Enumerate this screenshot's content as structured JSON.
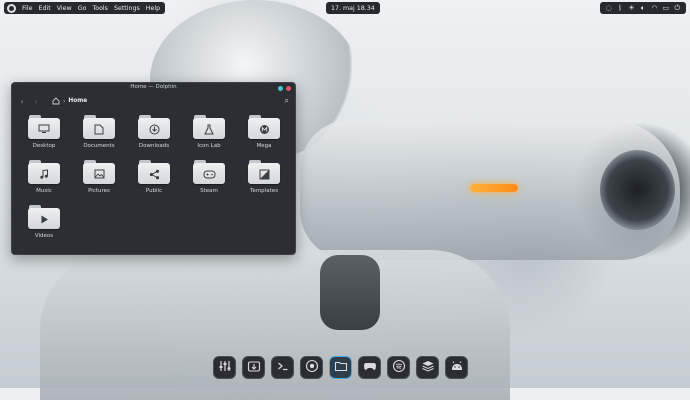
{
  "topbar": {
    "menu": [
      "File",
      "Edit",
      "View",
      "Go",
      "Tools",
      "Settings",
      "Help"
    ],
    "clock": "17. maj 18.34",
    "tray_icons": [
      "globe-icon",
      "bluetooth-icon",
      "sun-icon",
      "volume-icon",
      "wifi-icon",
      "battery-icon",
      "power-icon"
    ]
  },
  "window": {
    "title": "Home — Dolphin",
    "breadcrumb_current": "Home",
    "folders": [
      {
        "label": "Desktop",
        "icon": "desktop"
      },
      {
        "label": "Documents",
        "icon": "documents"
      },
      {
        "label": "Downloads",
        "icon": "downloads"
      },
      {
        "label": "Icon Lab",
        "icon": "flask"
      },
      {
        "label": "Mega",
        "icon": "mega"
      },
      {
        "label": "Music",
        "icon": "music"
      },
      {
        "label": "Pictures",
        "icon": "pictures"
      },
      {
        "label": "Public",
        "icon": "share"
      },
      {
        "label": "Steam",
        "icon": "gamepad"
      },
      {
        "label": "Templates",
        "icon": "templates"
      },
      {
        "label": "Videos",
        "icon": "video"
      }
    ],
    "buttons": {
      "close_color": "#e0546b",
      "max_color": "#4ec2d6"
    }
  },
  "dock": {
    "apps": [
      "mixer",
      "file-download",
      "terminal",
      "chrome",
      "files",
      "gamepad",
      "spotify",
      "stack",
      "android"
    ],
    "active": "files"
  }
}
